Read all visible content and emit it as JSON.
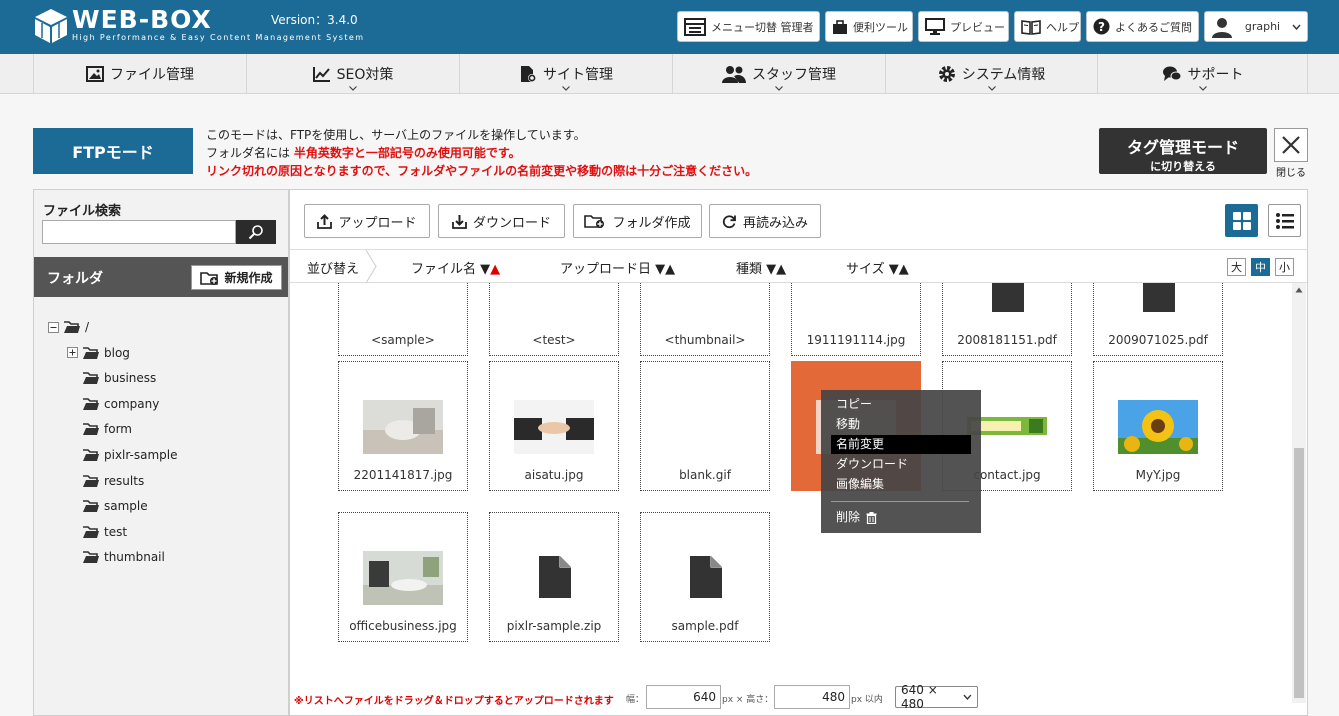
{
  "header": {
    "brand": "WEB-BOX",
    "tagline": "High Performance & Easy Content Management System",
    "version": "Version：3.4.0",
    "buttons": {
      "switch": "メニュー切替 管理者",
      "tools": "便利ツール",
      "preview": "プレビュー",
      "help": "ヘルプ",
      "faq": "よくあるご質問",
      "user": "graphi"
    }
  },
  "nav": {
    "file": "ファイル管理",
    "seo": "SEO対策",
    "site": "サイト管理",
    "staff": "スタッフ管理",
    "system": "システム情報",
    "support": "サポート"
  },
  "ftp": {
    "mode_label": "FTPモード",
    "notice_line1": "このモードは、FTPを使用し、サーバ上のファイルを操作しています。",
    "notice_line2_prefix": "フォルダ名には",
    "notice_line2_red": "半角英数字と一部記号のみ使用可能です。",
    "notice_line3": "リンク切れの原因となりますので、フォルダやファイルの名前変更や移動の際は十分ご注意ください。",
    "tag_mode_title": "タグ管理モード",
    "tag_mode_sub": "に切り替える",
    "close_label": "閉じる"
  },
  "sidebar": {
    "search_label": "ファイル検索",
    "search_value": "",
    "folder_label": "フォルダ",
    "new_folder": "新規作成",
    "tree": [
      {
        "label": "/",
        "toggle": "minus"
      },
      {
        "label": "blog",
        "toggle": "plus"
      },
      {
        "label": "business",
        "toggle": ""
      },
      {
        "label": "company",
        "toggle": ""
      },
      {
        "label": "form",
        "toggle": ""
      },
      {
        "label": "pixlr-sample",
        "toggle": ""
      },
      {
        "label": "results",
        "toggle": ""
      },
      {
        "label": "sample",
        "toggle": ""
      },
      {
        "label": "test",
        "toggle": ""
      },
      {
        "label": "thumbnail",
        "toggle": ""
      }
    ]
  },
  "toolbar": {
    "upload": "アップロード",
    "download": "ダウンロード",
    "new_folder": "フォルダ作成",
    "reload": "再読み込み"
  },
  "sort": {
    "label": "並び替え",
    "filename": "ファイル名",
    "upload_date": "アップロード日",
    "type": "種類",
    "size": "サイズ",
    "size_large": "大",
    "size_medium": "中",
    "size_small": "小",
    "arrows": "▼▲"
  },
  "files": [
    {
      "name": "<sample>",
      "kind": "folder"
    },
    {
      "name": "<test>",
      "kind": "folder"
    },
    {
      "name": "<thumbnail>",
      "kind": "folder"
    },
    {
      "name": "1911191114.jpg",
      "kind": "photo-dark"
    },
    {
      "name": "2008181151.pdf",
      "kind": "doc"
    },
    {
      "name": "2009071025.pdf",
      "kind": "doc"
    },
    {
      "name": "2201141817.jpg",
      "kind": "photo-office"
    },
    {
      "name": "aisatu.jpg",
      "kind": "photo-hands"
    },
    {
      "name": "blank.gif",
      "kind": "blank"
    },
    {
      "name": "",
      "kind": "selected"
    },
    {
      "name": "contact.jpg",
      "kind": "banner"
    },
    {
      "name": "MyY.jpg",
      "kind": "photo-sunflower"
    },
    {
      "name": "officebusiness.jpg",
      "kind": "photo-office2"
    },
    {
      "name": "pixlr-sample.zip",
      "kind": "doc"
    },
    {
      "name": "sample.pdf",
      "kind": "doc"
    }
  ],
  "context_menu": {
    "copy": "コピー",
    "move": "移動",
    "rename": "名前変更",
    "download": "ダウンロード",
    "edit_image": "画像編集",
    "delete": "削除"
  },
  "footer": {
    "note": "※リストへファイルをドラッグ＆ドロップするとアップロードされます",
    "width_label": "幅：",
    "width_value": "640",
    "height_label": "px × 高さ：",
    "height_value": "480",
    "limit_label": "px 以内",
    "preset": "640 × 480"
  },
  "colors": {
    "brand": "#1b6b96",
    "selected_tile": "#e36a38",
    "warning": "#e01010"
  }
}
